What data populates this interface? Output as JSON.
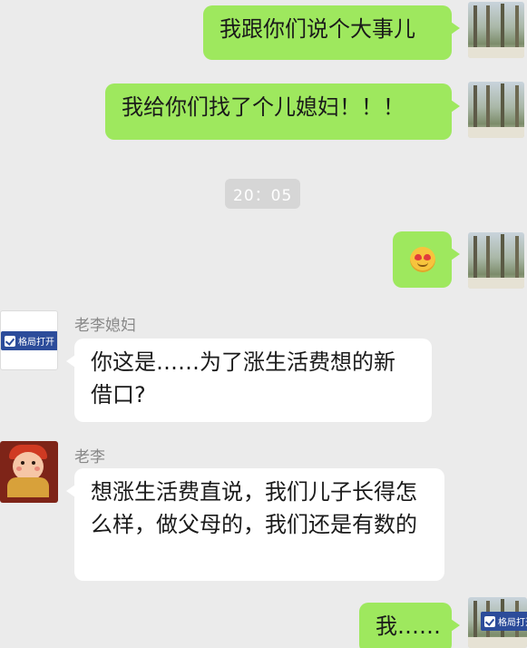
{
  "messages": {
    "m1": "我跟你们说个大事儿",
    "m2": "我给你们找了个儿媳妇！！！",
    "m4": "你这是……为了涨生活费想的新借口?",
    "m5": "想涨生活费直说，我们儿子长得怎么样，做父母的，我们还是有数的",
    "m6": "我……"
  },
  "timestamp": "20：05",
  "emoji": "smiling-face-with-heart-eyes-icon",
  "senders": {
    "wife": "老李媳妇",
    "li": "老李"
  },
  "watermark": "格局打开",
  "colors": {
    "background": "#ebebeb",
    "outgoing_bubble": "#9ee85e",
    "incoming_bubble": "#ffffff",
    "sender_name": "#888888",
    "timestamp_bg": "#d6d6d6",
    "badge": "#2c4c9a"
  }
}
